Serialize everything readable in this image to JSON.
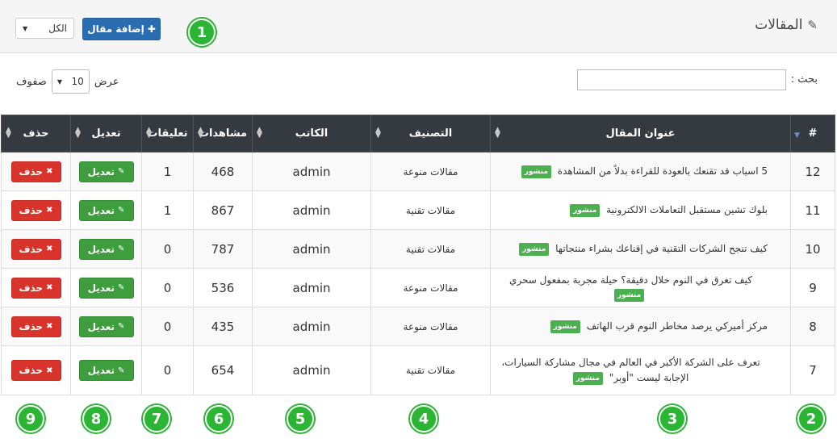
{
  "header": {
    "title": "المقالات",
    "title_icon": "pencil-icon",
    "add_button_label": "إضافة مقال",
    "add_button_icon": "plus-icon",
    "filter_value": "الكل"
  },
  "controls": {
    "search_label": "بحث :",
    "length_prefix": "عرض",
    "length_value": "10",
    "length_suffix": "صفوف"
  },
  "table": {
    "columns": [
      "#",
      "عنوان المقال",
      "التصنيف",
      "الكاتب",
      "مشاهدات",
      "تعليقات",
      "تعديل",
      "حذف"
    ],
    "edit_label": "تعديل",
    "delete_label": "حذف",
    "status_label": "منشور",
    "rows": [
      {
        "id": "12",
        "title": "5 اسباب قد تقنعك بالعودة للقراءة بدلاً من المشاهدة",
        "category": "مقالات منوعة",
        "author": "admin",
        "views": "468",
        "comments": "1"
      },
      {
        "id": "11",
        "title": "بلوك تشين مستقبل التعاملات الالكترونية",
        "category": "مقالات تقنية",
        "author": "admin",
        "views": "867",
        "comments": "1"
      },
      {
        "id": "10",
        "title": "كيف تنجح الشركات التقنية في إقناعك بشراء منتجاتها",
        "category": "مقالات تقنية",
        "author": "admin",
        "views": "787",
        "comments": "0"
      },
      {
        "id": "9",
        "title": "كيف تغرق في النوم خلال دقيقة؟ حيلة مجربة بمفعول سحري",
        "category": "مقالات منوعة",
        "author": "admin",
        "views": "536",
        "comments": "0"
      },
      {
        "id": "8",
        "title": "مركز أميركي يرصد مخاطر النوم قرب الهاتف",
        "category": "مقالات منوعة",
        "author": "admin",
        "views": "435",
        "comments": "0"
      },
      {
        "id": "7",
        "title": "تعرف على الشركة الأكبر في العالم في مجال مشاركة السيارات، الإجابة ليست \"أوبر\"",
        "category": "مقالات تقنية",
        "author": "admin",
        "views": "654",
        "comments": "0"
      }
    ]
  },
  "annotations": [
    "1",
    "2",
    "3",
    "4",
    "5",
    "6",
    "7",
    "8",
    "9"
  ],
  "colors": {
    "primary": "#2a6cb0",
    "success": "#3e9e3e",
    "danger": "#d9342b",
    "table_header": "#343a40",
    "annotation": "#2ab533"
  }
}
